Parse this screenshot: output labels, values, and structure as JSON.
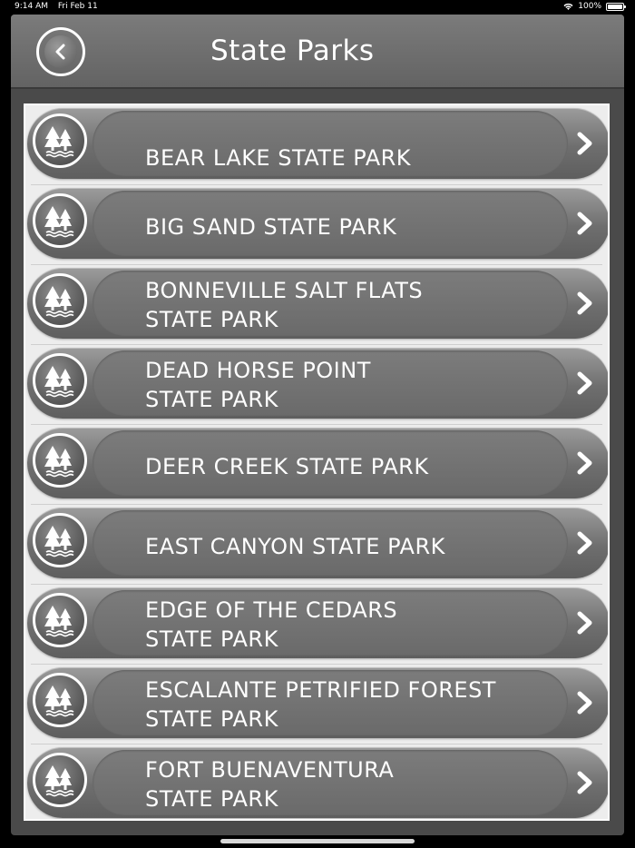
{
  "status_bar": {
    "time": "9:14 AM",
    "date": "Fri Feb 11",
    "battery": "100%"
  },
  "header": {
    "title": "State Parks",
    "back_icon": "back-circle-icon"
  },
  "parks": [
    {
      "line1": "BEAR LAKE STATE PARK",
      "line2": ""
    },
    {
      "line1": "BIG SAND STATE PARK",
      "line2": ""
    },
    {
      "line1": "BONNEVILLE SALT FLATS",
      "line2": "STATE PARK"
    },
    {
      "line1": "DEAD HORSE POINT",
      "line2": "STATE PARK"
    },
    {
      "line1": "DEER CREEK STATE PARK",
      "line2": ""
    },
    {
      "line1": "EAST CANYON STATE PARK",
      "line2": ""
    },
    {
      "line1": "EDGE OF THE CEDARS",
      "line2": "STATE PARK"
    },
    {
      "line1": "ESCALANTE PETRIFIED FOREST",
      "line2": "STATE PARK"
    },
    {
      "line1": "FORT BUENAVENTURA",
      "line2": "STATE PARK"
    }
  ],
  "colors": {
    "background": "#000000",
    "header": "#6e6e6e",
    "row": "#707070",
    "text": "#ffffff"
  }
}
